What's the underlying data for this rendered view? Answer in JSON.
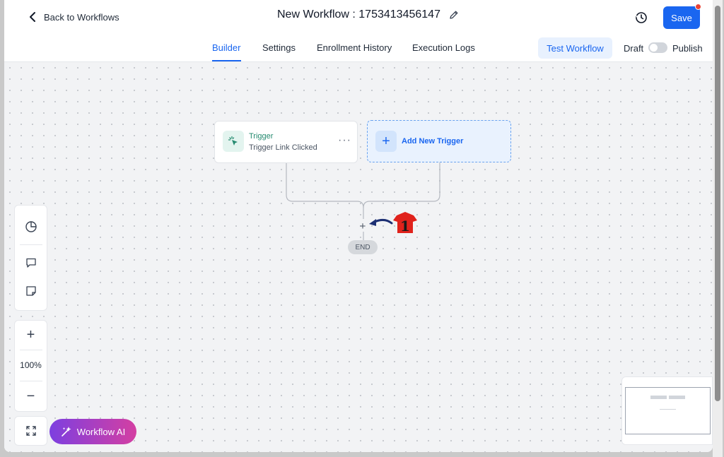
{
  "header": {
    "back_label": "Back to Workflows",
    "title": "New Workflow : 1753413456147",
    "save_label": "Save",
    "edit_icon": "pencil-icon",
    "history_icon": "history-icon"
  },
  "tabs": {
    "items": [
      "Builder",
      "Settings",
      "Enrollment History",
      "Execution Logs"
    ],
    "active": "Builder",
    "test_label": "Test Workflow",
    "draft_label": "Draft",
    "publish_label": "Publish",
    "publish_toggle_on": false
  },
  "canvas": {
    "trigger_title": "Trigger",
    "trigger_subtitle": "Trigger Link Clicked",
    "trigger_more": "···",
    "add_trigger_label": "Add New Trigger",
    "add_step_symbol": "+",
    "end_label": "END",
    "callout_number": "1"
  },
  "toolbar": {
    "zoom_level": "100%",
    "zoom_in": "+",
    "zoom_out": "−",
    "ai_label": "Workflow AI"
  },
  "colors": {
    "accent": "#1a66f0",
    "trigger_green": "#248a6f",
    "callout_red": "#e0221c",
    "arrow_navy": "#1c2f73"
  }
}
